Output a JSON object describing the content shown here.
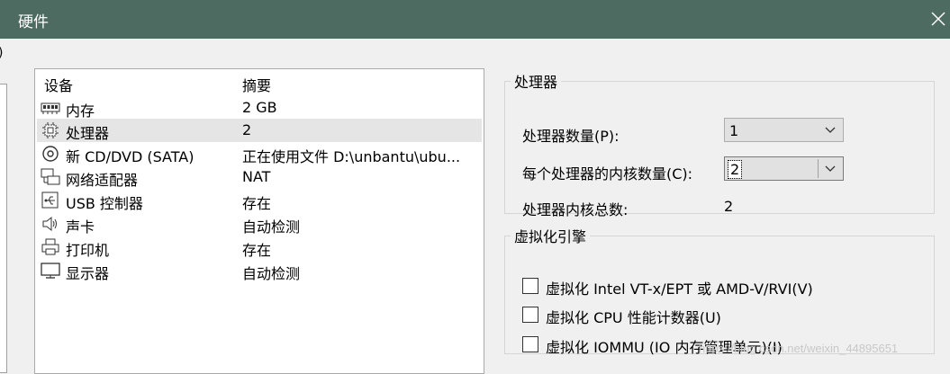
{
  "window": {
    "title": "硬件"
  },
  "left_edge": {
    "mark": ")"
  },
  "device_list": {
    "col_device": "设备",
    "col_summary": "摘要",
    "items": [
      {
        "name": "内存",
        "summary": "2 GB",
        "icon": "memory-icon"
      },
      {
        "name": "处理器",
        "summary": "2",
        "icon": "processor-icon",
        "selected": true
      },
      {
        "name": "新 CD/DVD (SATA)",
        "summary": "正在使用文件 D:\\unbantu\\ubu...",
        "icon": "cd-dvd-icon"
      },
      {
        "name": "网络适配器",
        "summary": "NAT",
        "icon": "network-adapter-icon"
      },
      {
        "name": "USB 控制器",
        "summary": "存在",
        "icon": "usb-icon"
      },
      {
        "name": "声卡",
        "summary": "自动检测",
        "icon": "speaker-icon"
      },
      {
        "name": "打印机",
        "summary": "存在",
        "icon": "printer-icon"
      },
      {
        "name": "显示器",
        "summary": "自动检测",
        "icon": "monitor-icon"
      }
    ]
  },
  "processor": {
    "legend": "处理器",
    "count_label": "处理器数量(P):",
    "count_value": "1",
    "cores_label": "每个处理器的内核数量(C):",
    "cores_value": "2",
    "total_label": "处理器内核总数:",
    "total_value": "2"
  },
  "virtualization": {
    "legend": "虚拟化引擎",
    "options": [
      {
        "label": "虚拟化 Intel VT-x/EPT 或 AMD-V/RVI(V)",
        "checked": false
      },
      {
        "label": "虚拟化 CPU 性能计数器(U)",
        "checked": false
      },
      {
        "label": "虚拟化 IOMMU (IO 内存管理单元)(I)",
        "checked": false
      }
    ]
  },
  "watermark": "https://blog.csdn.net/weixin_44895651",
  "colors": {
    "titlebar": "#4d6b60",
    "selected_row": "#e5e5e5",
    "background": "#f0f0f0"
  }
}
